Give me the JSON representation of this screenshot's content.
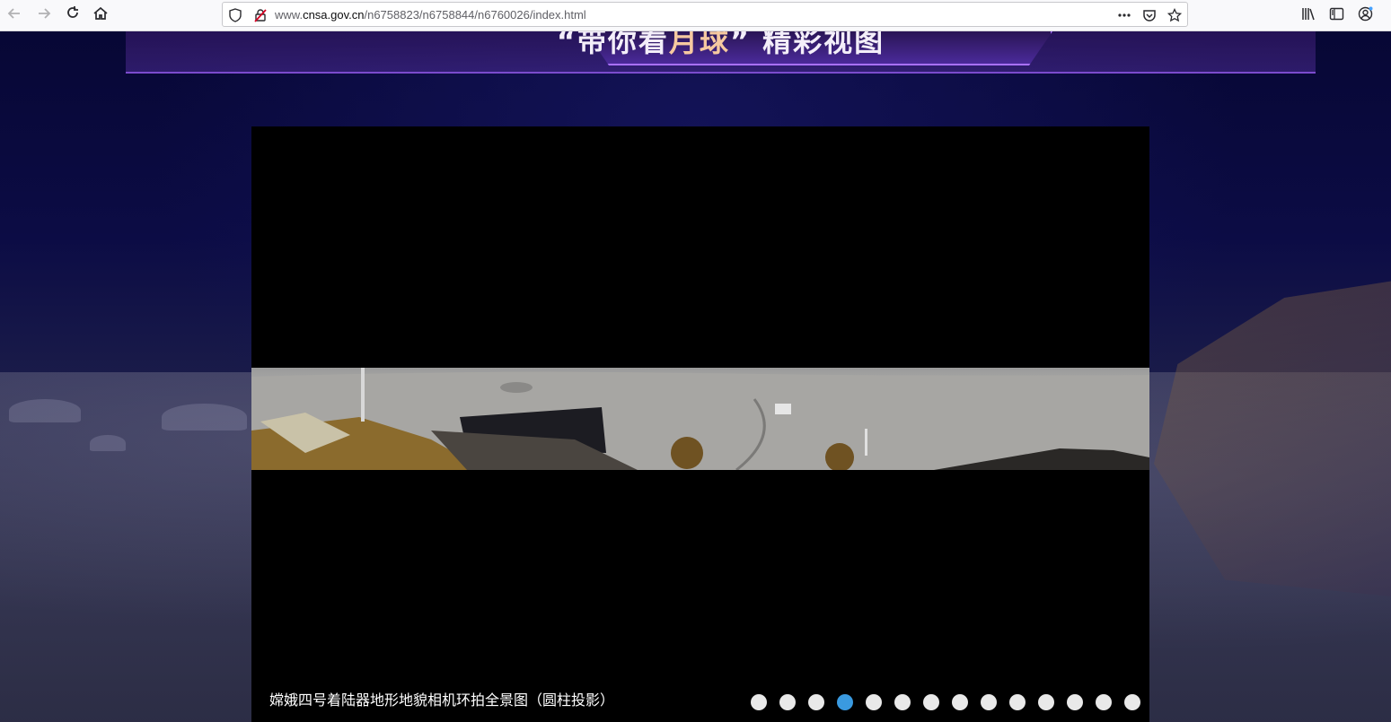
{
  "browser": {
    "url_prefix": "www.",
    "url_host": "cnsa.gov.cn",
    "url_path": "/n6758823/n6758844/n6760026/index.html",
    "icons": {
      "back": "back-arrow-icon",
      "forward": "forward-arrow-icon",
      "reload": "reload-icon",
      "home": "home-icon",
      "tracking": "shield-icon",
      "insecure": "insecure-lock-icon",
      "page_actions": "more-dots-icon",
      "pocket": "pocket-icon",
      "bookmark": "star-icon",
      "library": "library-icon",
      "sidebar": "sidebar-icon",
      "account": "account-icon"
    }
  },
  "page": {
    "banner_title_prefix": "“带你看",
    "banner_title_highlight": "月球",
    "banner_title_suffix": "” 精彩视图",
    "slide_caption": "嫦娥四号着陆器地形地貌相机环拍全景图（圆柱投影）",
    "slide_count": 14,
    "active_slide": 4,
    "colors": {
      "active_dot": "#3a9ae0",
      "inactive_dot": "#e9e9e9",
      "banner_accent": "#a870ff"
    }
  }
}
